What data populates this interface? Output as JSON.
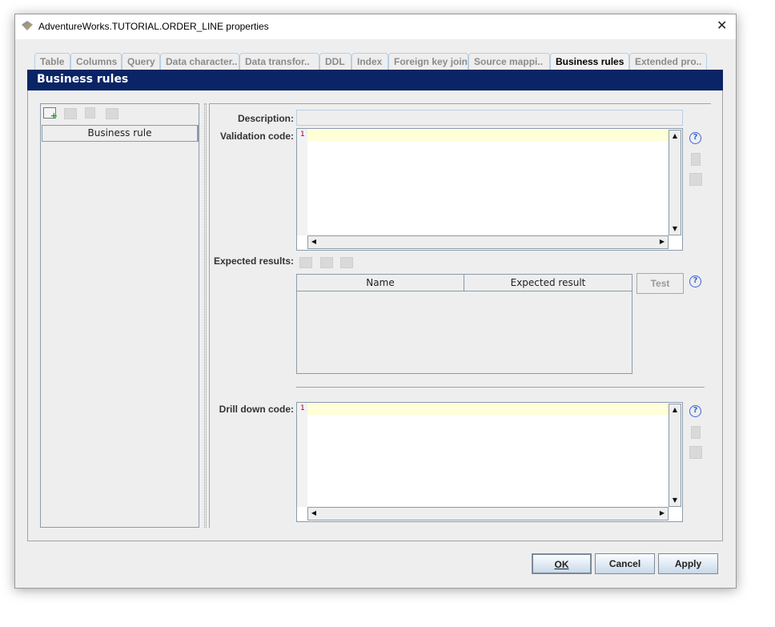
{
  "window": {
    "title": "AdventureWorks.TUTORIAL.ORDER_LINE properties",
    "close": "✕"
  },
  "tabs": [
    "Table",
    "Columns",
    "Query",
    "Data character..",
    "Data transfor..",
    "DDL",
    "Index",
    "Foreign key join",
    "Source mappi..",
    "Business rules",
    "Extended pro.."
  ],
  "active_tab": "Business rules",
  "section_title": "Business rules",
  "left": {
    "column_header": "Business rule"
  },
  "form": {
    "description_label": "Description:",
    "description_value": "",
    "validation_label": "Validation code:",
    "line_number": "1",
    "expected_label": "Expected results:",
    "expected_columns": [
      "Name",
      "Expected result"
    ],
    "test_button": "Test",
    "drilldown_label": "Drill down code:",
    "help": "?"
  },
  "buttons": {
    "ok": "OK",
    "cancel": "Cancel",
    "apply": "Apply"
  }
}
